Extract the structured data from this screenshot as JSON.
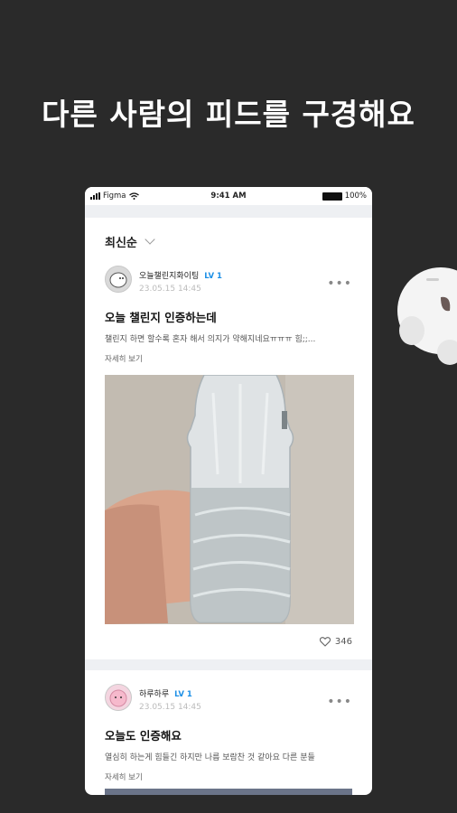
{
  "headline": "다른 사람의 피드를 구경해요",
  "status_bar": {
    "carrier": "Figma",
    "time": "9:41 AM",
    "battery": "100%"
  },
  "sort": {
    "label": "최신순"
  },
  "posts": [
    {
      "username": "오늘챌린지화이팅",
      "level": "LV 1",
      "date": "23.05.15 14:45",
      "title": "오늘 챌린지 인증하는데",
      "body": "챌린지 하면 할수록 혼자 해서 의지가 약해지네요ㅠㅠㅠ 힘;;...",
      "detail_link": "자세히 보기",
      "likes": "346"
    },
    {
      "username": "하루하루",
      "level": "LV 1",
      "date": "23.05.15 14:45",
      "title": "오늘도 인증해요",
      "body": "열심히 하는게 힘들긴 하지만 나름 보람찬 것 같아요 다른 분들",
      "detail_link": "자세히 보기"
    }
  ],
  "icons": {
    "more": "more-dots-icon",
    "heart": "heart-icon",
    "wifi": "wifi-icon",
    "chevron": "chevron-down-icon"
  },
  "colors": {
    "background": "#2a2a2a",
    "level_accent": "#1c8fe6"
  }
}
